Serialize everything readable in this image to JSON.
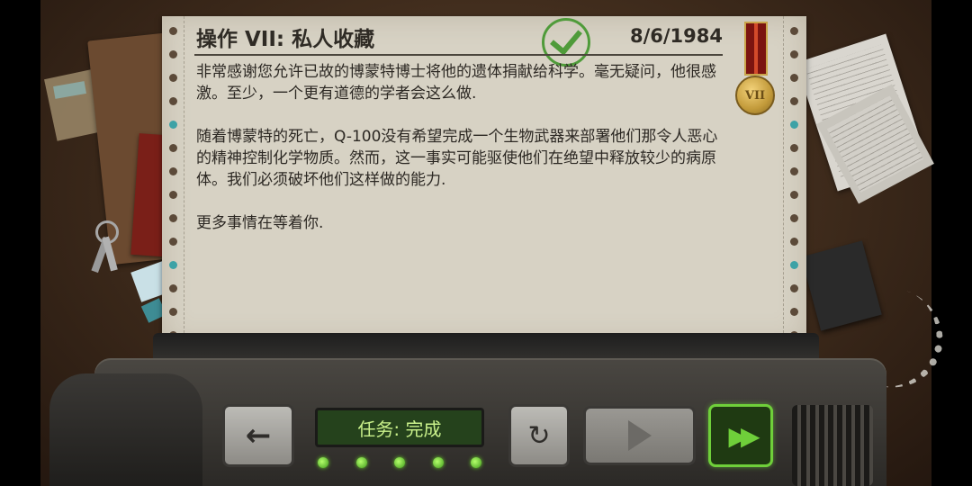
{
  "mission": {
    "title": "操作 VII: 私人收藏",
    "date": "8/6/1984",
    "medal_numeral": "VII",
    "paragraphs": [
      "非常感谢您允许已故的博蒙特博士将他的遗体捐献给科学。毫无疑问，他很感激。至少，一个更有道德的学者会这么做.",
      "随着博蒙特的死亡，Q-100没有希望完成一个生物武器来部署他们那令人恶心的精神控制化学物质。然而，这一事实可能驱使他们在绝望中释放较少的病原体。我们必须破坏他们这样做的能力.",
      "更多事情在等着你."
    ]
  },
  "controls": {
    "status_display": "任务: 完成",
    "back_icon": "arrow-left-icon",
    "retry_icon": "refresh-icon",
    "play_icon": "play-icon",
    "fast_forward_icon": "fast-forward-icon",
    "led_count": 5
  },
  "colors": {
    "accent_green": "#6fcf3a",
    "paper": "#d7d2c4",
    "display_text": "#c9f08a"
  }
}
